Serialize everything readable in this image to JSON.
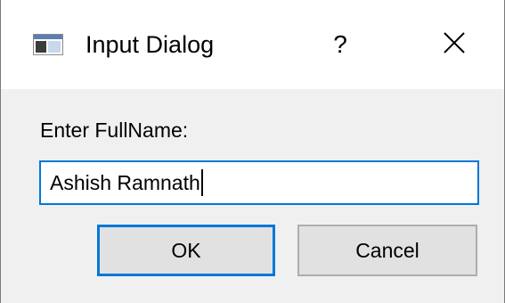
{
  "window": {
    "title": "Input Dialog",
    "help_label": "?",
    "close_icon": "close-icon",
    "app_icon": "app-window-icon"
  },
  "dialog": {
    "prompt_label": "Enter FullName:",
    "input_value": "Ashish Ramnath",
    "ok_label": "OK",
    "cancel_label": "Cancel"
  },
  "colors": {
    "focus_accent": "#0078d7",
    "body_background": "#f0f0f0",
    "titlebar_background": "#ffffff",
    "button_face": "#e1e1e1"
  }
}
